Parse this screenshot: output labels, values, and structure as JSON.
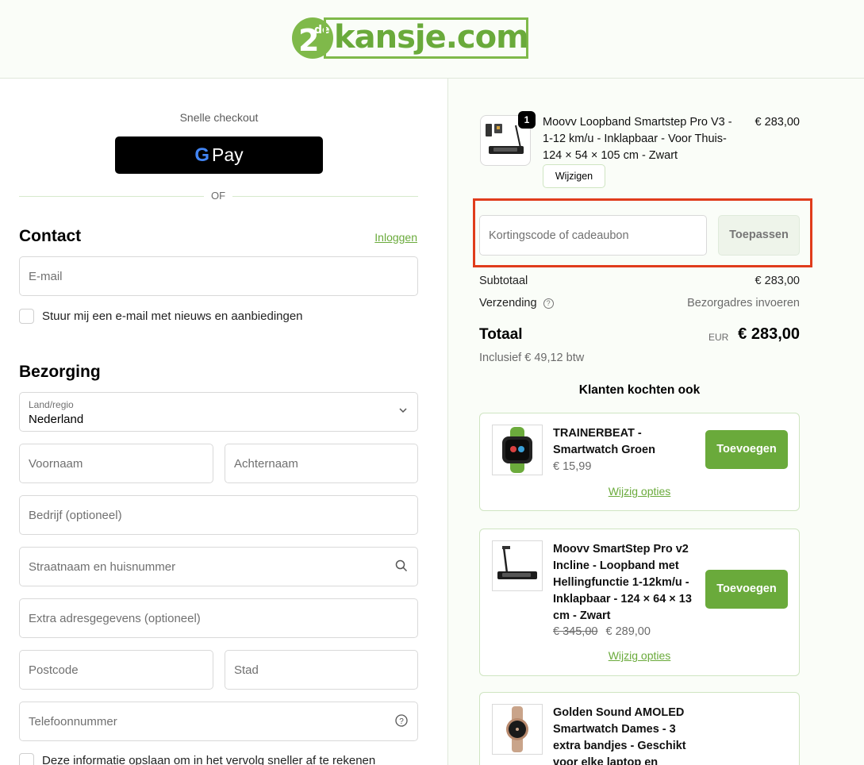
{
  "header": {
    "logo_text": "kansje.com",
    "logo_badge": "2de"
  },
  "left": {
    "express_label": "Snelle checkout",
    "gpay_g": "G",
    "gpay_pay": "Pay",
    "or_text": "OF",
    "contact": {
      "title": "Contact",
      "login_link": "Inloggen",
      "email_placeholder": "E-mail",
      "newsletter_label": "Stuur mij een e-mail met nieuws en aanbiedingen"
    },
    "delivery": {
      "title": "Bezorging",
      "country_label": "Land/regio",
      "country_value": "Nederland",
      "first_name": "Voornaam",
      "last_name": "Achternaam",
      "company": "Bedrijf (optioneel)",
      "street": "Straatnaam en huisnummer",
      "extra": "Extra adresgegevens (optioneel)",
      "postcode": "Postcode",
      "city": "Stad",
      "phone": "Telefoonnummer",
      "save_info_label": "Deze informatie opslaan om in het vervolg sneller af te rekenen"
    }
  },
  "right": {
    "product": {
      "quantity": "1",
      "title": "Moovv Loopband Smartstep Pro V3 - 1-12 km/u - Inklapbaar - Voor Thuis- 124 × 54 × 105 cm - Zwart",
      "price": "€ 283,00",
      "edit_label": "Wijzigen"
    },
    "discount": {
      "placeholder": "Kortingscode of cadeaubon",
      "apply_label": "Toepassen"
    },
    "summary": {
      "subtotal_label": "Subtotaal",
      "subtotal_value": "€ 283,00",
      "shipping_label": "Verzending",
      "shipping_value": "Bezorgadres invoeren",
      "total_label": "Totaal",
      "currency": "EUR",
      "total_value": "€ 283,00",
      "tax_line": "Inclusief € 49,12 btw"
    },
    "upsell": {
      "title": "Klanten kochten ook",
      "items": [
        {
          "name": "TRAINERBEAT - Smartwatch Groen",
          "price": "€ 15,99",
          "old_price": "",
          "add_label": "Toevoegen",
          "options_label": "Wijzig opties"
        },
        {
          "name": "Moovv SmartStep Pro v2 Incline - Loopband met Hellingfunctie 1-12km/u - Inklapbaar - 124 × 64 × 13 cm - Zwart",
          "price": "€ 289,00",
          "old_price": "€ 345,00",
          "add_label": "Toevoegen",
          "options_label": "Wijzig opties"
        },
        {
          "name": "Golden Sound AMOLED Smartwatch Dames - 3 extra bandjes - Geschikt voor elke laptop en",
          "price": "",
          "old_price": "",
          "add_label": "",
          "options_label": ""
        }
      ]
    }
  }
}
